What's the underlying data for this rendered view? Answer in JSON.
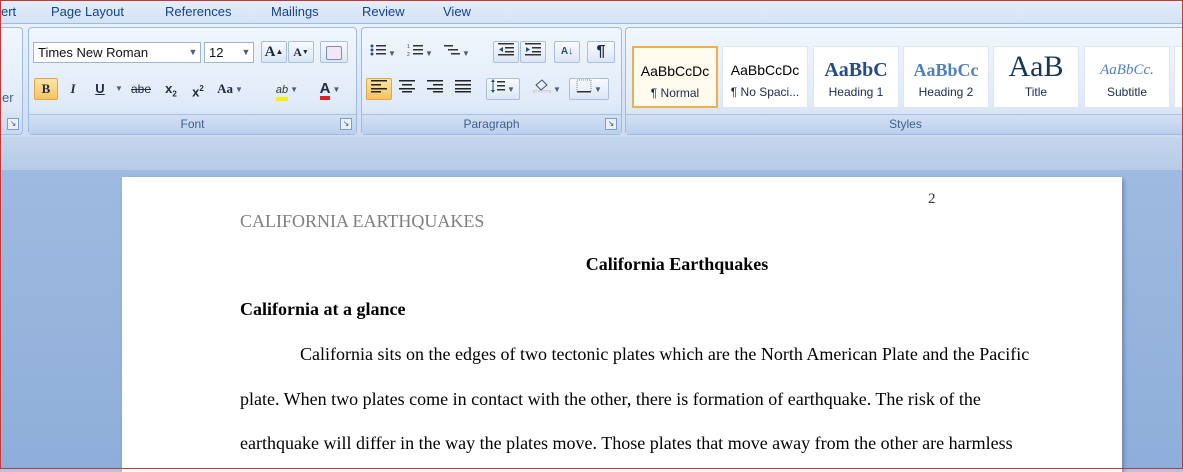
{
  "tabs": [
    "ert",
    "Page Layout",
    "References",
    "Mailings",
    "Review",
    "View"
  ],
  "clipboard": {
    "label_fragment": "er"
  },
  "font": {
    "name": "Times New Roman",
    "size": "12",
    "grow_label": "A",
    "shrink_label": "A",
    "bold": "B",
    "italic": "I",
    "underline": "U",
    "strike": "abe",
    "subscript": "x",
    "superscript": "x",
    "change_case": "Aa",
    "highlight": "ab",
    "font_color": "A",
    "group_label": "Font"
  },
  "paragraph": {
    "group_label": "Paragraph",
    "sort": "A↓",
    "pilcrow": "¶"
  },
  "styles": {
    "group_label": "Styles",
    "items": [
      {
        "sample": "AaBbCcDc",
        "name": "¶ Normal"
      },
      {
        "sample": "AaBbCcDc",
        "name": "¶ No Spaci..."
      },
      {
        "sample": "AaBbC",
        "name": "Heading 1"
      },
      {
        "sample": "AaBbCc",
        "name": "Heading 2"
      },
      {
        "sample": "AaB",
        "name": "Title"
      },
      {
        "sample": "AaBbCc.",
        "name": "Subtitle"
      }
    ]
  },
  "document": {
    "page_number": "2",
    "running_head": "CALIFORNIA EARTHQUAKES",
    "title": "California Earthquakes",
    "heading": "California at a glance",
    "lines": [
      "California sits on the edges of two tectonic plates which are the North American Plate and the Pacific",
      "plate. When two plates come in contact with the other, there is formation of earthquake. The risk of the",
      "earthquake will differ in the way the plates move. Those plates that move away from the other are harmless"
    ]
  },
  "colors": {
    "accent": "#15428b",
    "selected_style": "#e9b150",
    "font_color_bar": "#e02020",
    "highlight_bar": "#f5f200"
  }
}
